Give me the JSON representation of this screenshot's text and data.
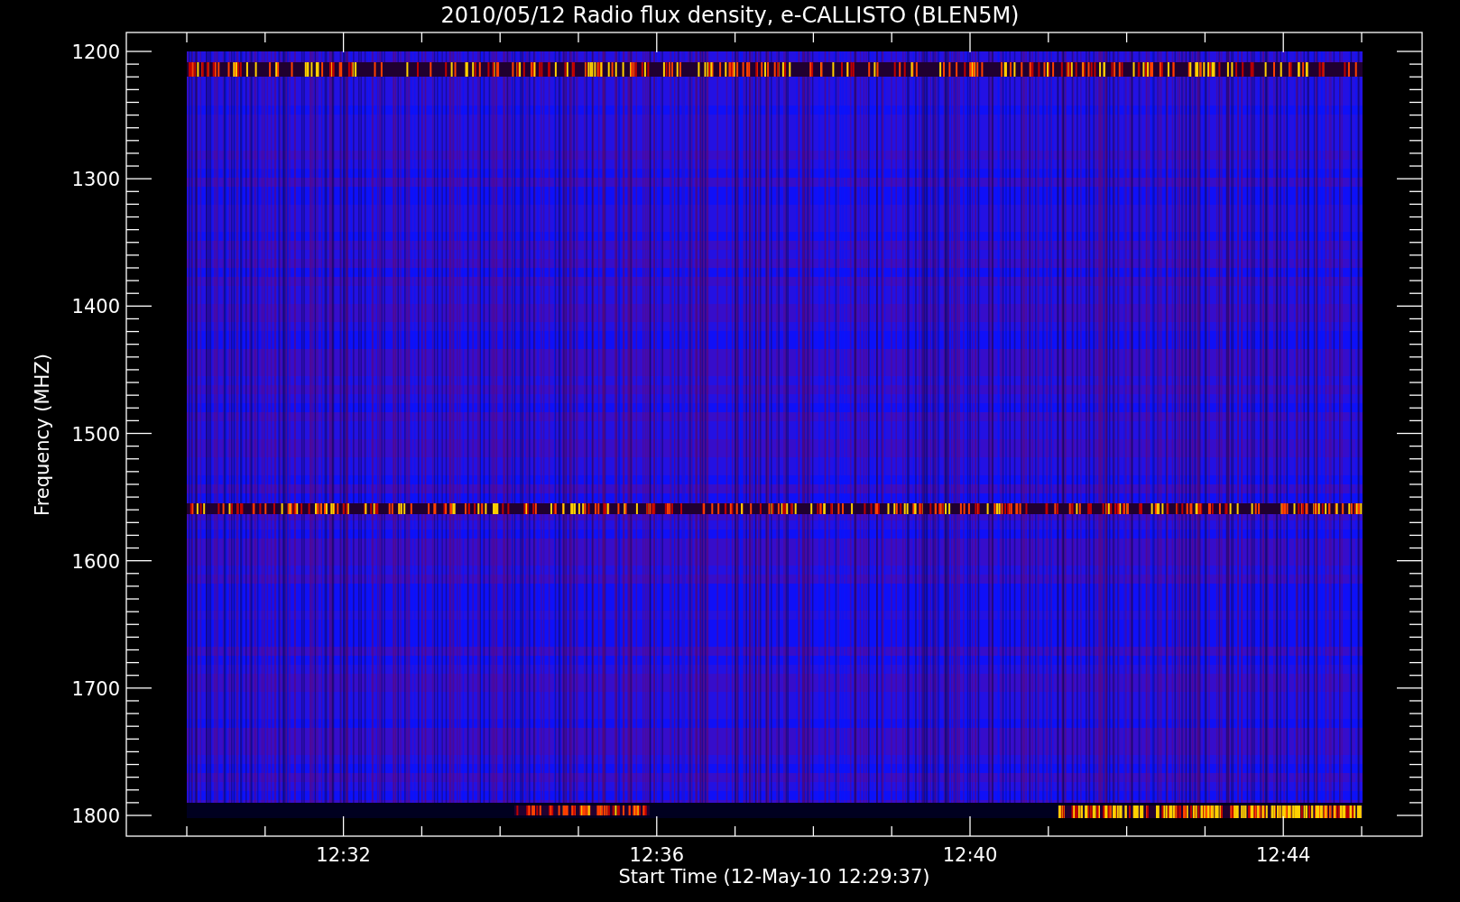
{
  "title": "2010/05/12  Radio flux density, e-CALLISTO (BLEN5M)",
  "y_axis": {
    "label": "Frequency (MHZ)",
    "ticks": [
      "1200",
      "1300",
      "1400",
      "1500",
      "1600",
      "1700",
      "1800"
    ]
  },
  "x_axis": {
    "label": "Start Time (12-May-10 12:29:37)",
    "ticks": [
      "12:32",
      "12:36",
      "12:40",
      "12:44"
    ]
  }
}
